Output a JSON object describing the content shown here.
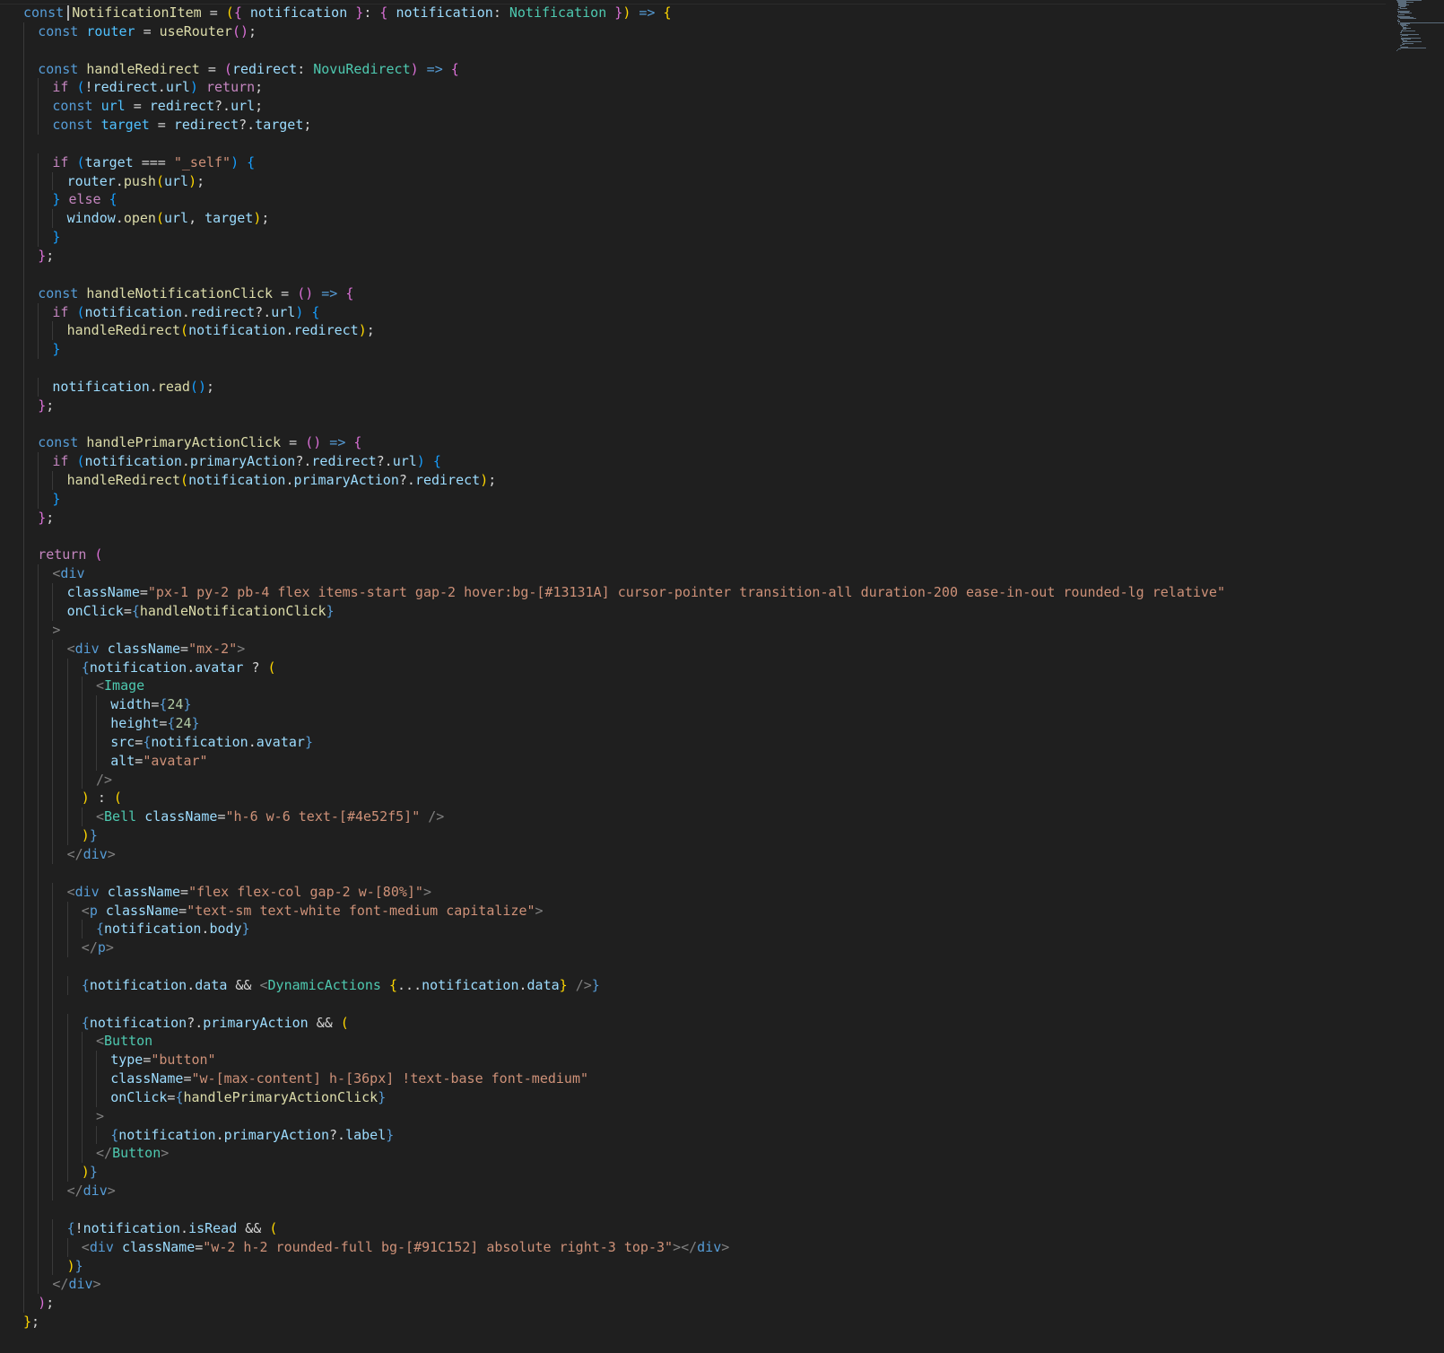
{
  "editor": {
    "language": "tsx",
    "cursor": {
      "line": 1,
      "column": 7
    },
    "lines": [
      [
        [
          "k",
          "const "
        ],
        [
          "f",
          "NotificationItem"
        ],
        [
          "o",
          " = "
        ],
        [
          "b1",
          "("
        ],
        [
          "b2",
          "{ "
        ],
        [
          "v",
          "notification "
        ],
        [
          "b2",
          "}"
        ],
        [
          "o",
          ": "
        ],
        [
          "b2",
          "{ "
        ],
        [
          "v",
          "notification"
        ],
        [
          "o",
          ": "
        ],
        [
          "t",
          "Notification "
        ],
        [
          "b2",
          "}"
        ],
        [
          "b1",
          ")"
        ],
        [
          "k",
          " => "
        ],
        [
          "b1",
          "{"
        ]
      ],
      [
        [
          "k",
          "const "
        ],
        [
          "c",
          "router"
        ],
        [
          "o",
          " = "
        ],
        [
          "f",
          "useRouter"
        ],
        [
          "b2",
          "()"
        ],
        [
          "o",
          ";"
        ]
      ],
      [],
      [
        [
          "k",
          "const "
        ],
        [
          "f",
          "handleRedirect"
        ],
        [
          "o",
          " = "
        ],
        [
          "b2",
          "("
        ],
        [
          "v",
          "redirect"
        ],
        [
          "o",
          ": "
        ],
        [
          "t",
          "NovuRedirect"
        ],
        [
          "b2",
          ")"
        ],
        [
          "k",
          " => "
        ],
        [
          "b2",
          "{"
        ]
      ],
      [
        [
          "kc",
          "if "
        ],
        [
          "b3",
          "("
        ],
        [
          "o",
          "!"
        ],
        [
          "v",
          "redirect"
        ],
        [
          "o",
          "."
        ],
        [
          "v",
          "url"
        ],
        [
          "b3",
          ")"
        ],
        [
          "kc",
          " return"
        ],
        [
          "o",
          ";"
        ]
      ],
      [
        [
          "k",
          "const "
        ],
        [
          "c",
          "url"
        ],
        [
          "o",
          " = "
        ],
        [
          "v",
          "redirect"
        ],
        [
          "o",
          "?."
        ],
        [
          "v",
          "url"
        ],
        [
          "o",
          ";"
        ]
      ],
      [
        [
          "k",
          "const "
        ],
        [
          "c",
          "target"
        ],
        [
          "o",
          " = "
        ],
        [
          "v",
          "redirect"
        ],
        [
          "o",
          "?."
        ],
        [
          "v",
          "target"
        ],
        [
          "o",
          ";"
        ]
      ],
      [],
      [
        [
          "kc",
          "if "
        ],
        [
          "b3",
          "("
        ],
        [
          "v",
          "target"
        ],
        [
          "o",
          " === "
        ],
        [
          "s",
          "\"_self\""
        ],
        [
          "b3",
          ")"
        ],
        [
          "b3",
          " {"
        ]
      ],
      [
        [
          "v",
          "router"
        ],
        [
          "o",
          "."
        ],
        [
          "f",
          "push"
        ],
        [
          "b1",
          "("
        ],
        [
          "v",
          "url"
        ],
        [
          "b1",
          ")"
        ],
        [
          "o",
          ";"
        ]
      ],
      [
        [
          "b3",
          "} "
        ],
        [
          "kc",
          "else "
        ],
        [
          "b3",
          "{"
        ]
      ],
      [
        [
          "v",
          "window"
        ],
        [
          "o",
          "."
        ],
        [
          "f",
          "open"
        ],
        [
          "b1",
          "("
        ],
        [
          "v",
          "url"
        ],
        [
          "o",
          ", "
        ],
        [
          "v",
          "target"
        ],
        [
          "b1",
          ")"
        ],
        [
          "o",
          ";"
        ]
      ],
      [
        [
          "b3",
          "}"
        ]
      ],
      [
        [
          "b2",
          "}"
        ],
        [
          "o",
          ";"
        ]
      ],
      [],
      [
        [
          "k",
          "const "
        ],
        [
          "f",
          "handleNotificationClick"
        ],
        [
          "o",
          " = "
        ],
        [
          "b2",
          "()"
        ],
        [
          "k",
          " => "
        ],
        [
          "b2",
          "{"
        ]
      ],
      [
        [
          "kc",
          "if "
        ],
        [
          "b3",
          "("
        ],
        [
          "v",
          "notification"
        ],
        [
          "o",
          "."
        ],
        [
          "v",
          "redirect"
        ],
        [
          "o",
          "?."
        ],
        [
          "v",
          "url"
        ],
        [
          "b3",
          ")"
        ],
        [
          "b3",
          " {"
        ]
      ],
      [
        [
          "f",
          "handleRedirect"
        ],
        [
          "b1",
          "("
        ],
        [
          "v",
          "notification"
        ],
        [
          "o",
          "."
        ],
        [
          "v",
          "redirect"
        ],
        [
          "b1",
          ")"
        ],
        [
          "o",
          ";"
        ]
      ],
      [
        [
          "b3",
          "}"
        ]
      ],
      [],
      [
        [
          "v",
          "notification"
        ],
        [
          "o",
          "."
        ],
        [
          "f",
          "read"
        ],
        [
          "b3",
          "()"
        ],
        [
          "o",
          ";"
        ]
      ],
      [
        [
          "b2",
          "}"
        ],
        [
          "o",
          ";"
        ]
      ],
      [],
      [
        [
          "k",
          "const "
        ],
        [
          "f",
          "handlePrimaryActionClick"
        ],
        [
          "o",
          " = "
        ],
        [
          "b2",
          "()"
        ],
        [
          "k",
          " => "
        ],
        [
          "b2",
          "{"
        ]
      ],
      [
        [
          "kc",
          "if "
        ],
        [
          "b3",
          "("
        ],
        [
          "v",
          "notification"
        ],
        [
          "o",
          "."
        ],
        [
          "v",
          "primaryAction"
        ],
        [
          "o",
          "?."
        ],
        [
          "v",
          "redirect"
        ],
        [
          "o",
          "?."
        ],
        [
          "v",
          "url"
        ],
        [
          "b3",
          ")"
        ],
        [
          "b3",
          " {"
        ]
      ],
      [
        [
          "f",
          "handleRedirect"
        ],
        [
          "b1",
          "("
        ],
        [
          "v",
          "notification"
        ],
        [
          "o",
          "."
        ],
        [
          "v",
          "primaryAction"
        ],
        [
          "o",
          "?."
        ],
        [
          "v",
          "redirect"
        ],
        [
          "b1",
          ")"
        ],
        [
          "o",
          ";"
        ]
      ],
      [
        [
          "b3",
          "}"
        ]
      ],
      [
        [
          "b2",
          "}"
        ],
        [
          "o",
          ";"
        ]
      ],
      [],
      [
        [
          "kc",
          "return "
        ],
        [
          "b2",
          "("
        ]
      ],
      [
        [
          "g",
          "<"
        ],
        [
          "k",
          "div"
        ]
      ],
      [
        [
          "v",
          "className"
        ],
        [
          "o",
          "="
        ],
        [
          "s",
          "\"px-1 py-2 pb-4 flex items-start gap-2 hover:bg-[#13131A] cursor-pointer transition-all duration-200 ease-in-out rounded-lg relative\""
        ]
      ],
      [
        [
          "v",
          "onClick"
        ],
        [
          "o",
          "="
        ],
        [
          "k",
          "{"
        ],
        [
          "f",
          "handleNotificationClick"
        ],
        [
          "k",
          "}"
        ]
      ],
      [
        [
          "g",
          ">"
        ]
      ],
      [
        [
          "g",
          "<"
        ],
        [
          "k",
          "div "
        ],
        [
          "v",
          "className"
        ],
        [
          "o",
          "="
        ],
        [
          "s",
          "\"mx-2\""
        ],
        [
          "g",
          ">"
        ]
      ],
      [
        [
          "k",
          "{"
        ],
        [
          "v",
          "notification"
        ],
        [
          "o",
          "."
        ],
        [
          "v",
          "avatar"
        ],
        [
          "o",
          " ? "
        ],
        [
          "b1",
          "("
        ]
      ],
      [
        [
          "g",
          "<"
        ],
        [
          "t",
          "Image"
        ]
      ],
      [
        [
          "v",
          "width"
        ],
        [
          "o",
          "="
        ],
        [
          "k",
          "{"
        ],
        [
          "n",
          "24"
        ],
        [
          "k",
          "}"
        ]
      ],
      [
        [
          "v",
          "height"
        ],
        [
          "o",
          "="
        ],
        [
          "k",
          "{"
        ],
        [
          "n",
          "24"
        ],
        [
          "k",
          "}"
        ]
      ],
      [
        [
          "v",
          "src"
        ],
        [
          "o",
          "="
        ],
        [
          "k",
          "{"
        ],
        [
          "v",
          "notification"
        ],
        [
          "o",
          "."
        ],
        [
          "v",
          "avatar"
        ],
        [
          "k",
          "}"
        ]
      ],
      [
        [
          "v",
          "alt"
        ],
        [
          "o",
          "="
        ],
        [
          "s",
          "\"avatar\""
        ]
      ],
      [
        [
          "g",
          "/>"
        ]
      ],
      [
        [
          "b1",
          ")"
        ],
        [
          "o",
          " : "
        ],
        [
          "b1",
          "("
        ]
      ],
      [
        [
          "g",
          "<"
        ],
        [
          "t",
          "Bell "
        ],
        [
          "v",
          "className"
        ],
        [
          "o",
          "="
        ],
        [
          "s",
          "\"h-6 w-6 text-[#4e52f5]\""
        ],
        [
          "g",
          " />"
        ]
      ],
      [
        [
          "b1",
          ")"
        ],
        [
          "k",
          "}"
        ]
      ],
      [
        [
          "g",
          "</"
        ],
        [
          "k",
          "div"
        ],
        [
          "g",
          ">"
        ]
      ],
      [],
      [
        [
          "g",
          "<"
        ],
        [
          "k",
          "div "
        ],
        [
          "v",
          "className"
        ],
        [
          "o",
          "="
        ],
        [
          "s",
          "\"flex flex-col gap-2 w-[80%]\""
        ],
        [
          "g",
          ">"
        ]
      ],
      [
        [
          "g",
          "<"
        ],
        [
          "k",
          "p "
        ],
        [
          "v",
          "className"
        ],
        [
          "o",
          "="
        ],
        [
          "s",
          "\"text-sm text-white font-medium capitalize\""
        ],
        [
          "g",
          ">"
        ]
      ],
      [
        [
          "k",
          "{"
        ],
        [
          "v",
          "notification"
        ],
        [
          "o",
          "."
        ],
        [
          "v",
          "body"
        ],
        [
          "k",
          "}"
        ]
      ],
      [
        [
          "g",
          "</"
        ],
        [
          "k",
          "p"
        ],
        [
          "g",
          ">"
        ]
      ],
      [],
      [
        [
          "k",
          "{"
        ],
        [
          "v",
          "notification"
        ],
        [
          "o",
          "."
        ],
        [
          "v",
          "data"
        ],
        [
          "o",
          " && "
        ],
        [
          "g",
          "<"
        ],
        [
          "t",
          "DynamicActions "
        ],
        [
          "b1",
          "{"
        ],
        [
          "o",
          "..."
        ],
        [
          "v",
          "notification"
        ],
        [
          "o",
          "."
        ],
        [
          "v",
          "data"
        ],
        [
          "b1",
          "}"
        ],
        [
          "g",
          " />"
        ],
        [
          "k",
          "}"
        ]
      ],
      [],
      [
        [
          "k",
          "{"
        ],
        [
          "v",
          "notification"
        ],
        [
          "o",
          "?."
        ],
        [
          "v",
          "primaryAction"
        ],
        [
          "o",
          " && "
        ],
        [
          "b1",
          "("
        ]
      ],
      [
        [
          "g",
          "<"
        ],
        [
          "t",
          "Button"
        ]
      ],
      [
        [
          "v",
          "type"
        ],
        [
          "o",
          "="
        ],
        [
          "s",
          "\"button\""
        ]
      ],
      [
        [
          "v",
          "className"
        ],
        [
          "o",
          "="
        ],
        [
          "s",
          "\"w-[max-content] h-[36px] !text-base font-medium\""
        ]
      ],
      [
        [
          "v",
          "onClick"
        ],
        [
          "o",
          "="
        ],
        [
          "k",
          "{"
        ],
        [
          "f",
          "handlePrimaryActionClick"
        ],
        [
          "k",
          "}"
        ]
      ],
      [
        [
          "g",
          ">"
        ]
      ],
      [
        [
          "k",
          "{"
        ],
        [
          "v",
          "notification"
        ],
        [
          "o",
          "."
        ],
        [
          "v",
          "primaryAction"
        ],
        [
          "o",
          "?."
        ],
        [
          "v",
          "label"
        ],
        [
          "k",
          "}"
        ]
      ],
      [
        [
          "g",
          "</"
        ],
        [
          "t",
          "Button"
        ],
        [
          "g",
          ">"
        ]
      ],
      [
        [
          "b1",
          ")"
        ],
        [
          "k",
          "}"
        ]
      ],
      [
        [
          "g",
          "</"
        ],
        [
          "k",
          "div"
        ],
        [
          "g",
          ">"
        ]
      ],
      [],
      [
        [
          "k",
          "{"
        ],
        [
          "o",
          "!"
        ],
        [
          "v",
          "notification"
        ],
        [
          "o",
          "."
        ],
        [
          "v",
          "isRead"
        ],
        [
          "o",
          " && "
        ],
        [
          "b1",
          "("
        ]
      ],
      [
        [
          "g",
          "<"
        ],
        [
          "k",
          "div "
        ],
        [
          "v",
          "className"
        ],
        [
          "o",
          "="
        ],
        [
          "s",
          "\"w-2 h-2 rounded-full bg-[#91C152] absolute right-3 top-3\""
        ],
        [
          "g",
          "></"
        ],
        [
          "k",
          "div"
        ],
        [
          "g",
          ">"
        ]
      ],
      [
        [
          "b1",
          ")"
        ],
        [
          "k",
          "}"
        ]
      ],
      [
        [
          "g",
          "</"
        ],
        [
          "k",
          "div"
        ],
        [
          "g",
          ">"
        ]
      ],
      [
        [
          "b2",
          ")"
        ],
        [
          "o",
          ";"
        ]
      ],
      [
        [
          "b1",
          "}"
        ],
        [
          "o",
          ";"
        ]
      ]
    ]
  }
}
